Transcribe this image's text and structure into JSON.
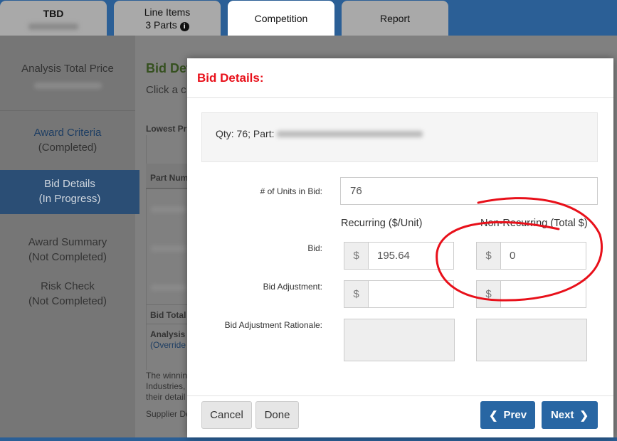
{
  "tabs": [
    {
      "label": "TBD"
    },
    {
      "label": "Line Items",
      "sub": "3 Parts",
      "icon": "info-circle-icon"
    },
    {
      "label": "Competition",
      "active": true
    },
    {
      "label": "Report"
    }
  ],
  "sidebar": {
    "total_label": "Analysis Total Price",
    "items": [
      {
        "label": "Award Criteria",
        "status": "(Completed)"
      },
      {
        "label": "Bid Details",
        "status": "(In Progress)"
      },
      {
        "label": "Award Summary",
        "status": "(Not Completed)"
      },
      {
        "label": "Risk Check",
        "status": "(Not Completed)"
      }
    ]
  },
  "main": {
    "title": "Bid Det",
    "instruction": "Click a c",
    "lowest": "Lowest Pr",
    "col_part": "Part Num",
    "bid_total": "Bid Total",
    "analysis": "Analysis T",
    "override": "(Override",
    "footer_lines": [
      "The winnin",
      "Industries,",
      "their detail"
    ],
    "supplier": "Supplier De"
  },
  "modal": {
    "title": "Bid Details:",
    "qty_label": "Qty: 76;  Part:",
    "units_label": "# of Units in Bid:",
    "units_value": "76",
    "col_recurring": "Recurring ($/Unit)",
    "col_nonrecurring": "Non-Recurring (Total $)",
    "bid_label": "Bid:",
    "bid_recurring": "195.64",
    "bid_nonrecurring": "0",
    "adj_label": "Bid Adjustment:",
    "rationale_label": "Bid Adjustment Rationale:",
    "currency": "$",
    "cancel": "Cancel",
    "done": "Done",
    "prev": "Prev",
    "next": "Next"
  },
  "colors": {
    "accent": "#2866a3",
    "title_red": "#e8101a",
    "annotation": "#e8101a"
  }
}
